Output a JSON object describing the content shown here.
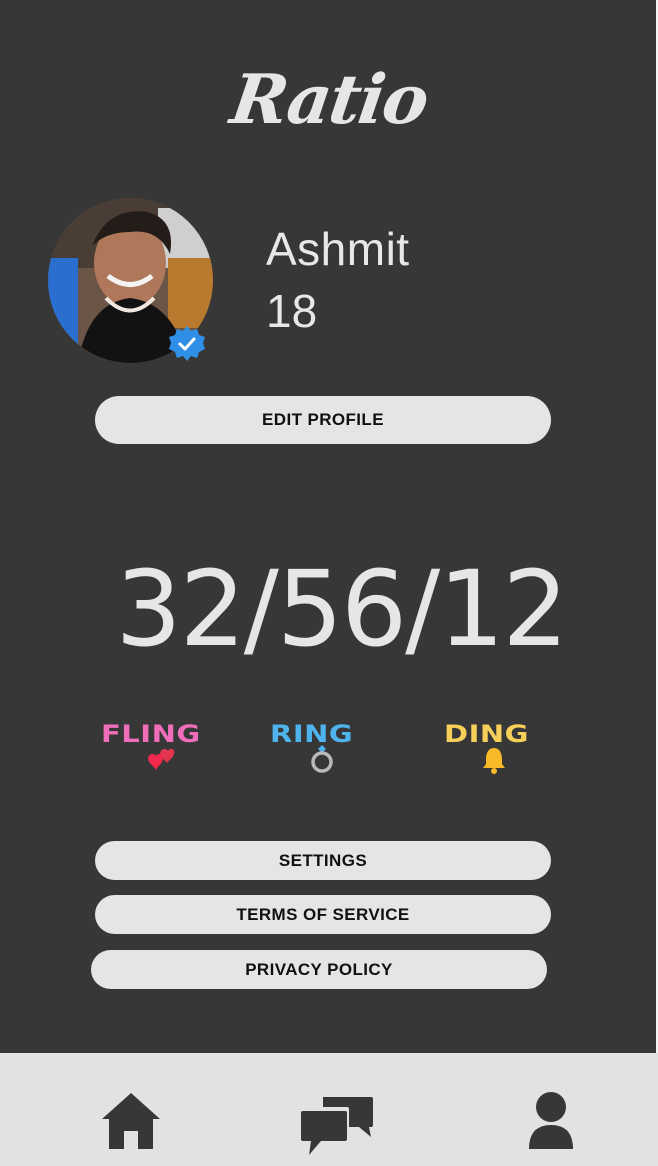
{
  "app": {
    "logo_text": "Ratio"
  },
  "profile": {
    "name": "Ashmit",
    "age": "18",
    "verified": true,
    "edit_label": "EDIT PROFILE"
  },
  "stats": {
    "ratio_text": "32/56/12",
    "categories": [
      {
        "label": "FLING",
        "color": "#f06dbb",
        "icon": "two-hearts-icon"
      },
      {
        "label": "RING",
        "color": "#4fb4ee",
        "icon": "ring-icon"
      },
      {
        "label": "DING",
        "color": "#f7d05a",
        "icon": "bell-icon"
      }
    ]
  },
  "menu": {
    "settings_label": "SETTINGS",
    "terms_label": "TERMS OF SERVICE",
    "privacy_label": "PRIVACY POLICY"
  },
  "nav": {
    "items": [
      {
        "icon": "home-icon"
      },
      {
        "icon": "chat-icon"
      },
      {
        "icon": "profile-icon"
      }
    ]
  },
  "colors": {
    "background": "#373737",
    "button": "#e5e5e5",
    "nav_background": "#e2e2e2",
    "verified_badge": "#2f8fe6"
  }
}
